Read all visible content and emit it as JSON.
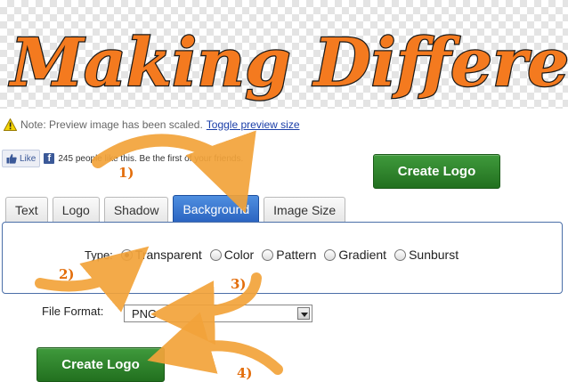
{
  "preview": {
    "logo_text": "Making Different"
  },
  "note": {
    "text": "Note: Preview image has been scaled.",
    "toggle_link": "Toggle preview size"
  },
  "social": {
    "like_label": "Like",
    "like_text": "245 people like this. Be the first of your friends."
  },
  "buttons": {
    "create_logo": "Create Logo"
  },
  "tabs": [
    {
      "label": "Text"
    },
    {
      "label": "Logo"
    },
    {
      "label": "Shadow"
    },
    {
      "label": "Background"
    },
    {
      "label": "Image Size"
    }
  ],
  "background": {
    "type_label": "Type:",
    "options": [
      {
        "label": "Transparent",
        "checked": true
      },
      {
        "label": "Color",
        "checked": false
      },
      {
        "label": "Pattern",
        "checked": false
      },
      {
        "label": "Gradient",
        "checked": false
      },
      {
        "label": "Sunburst",
        "checked": false
      }
    ]
  },
  "file_format": {
    "label": "File Format:",
    "value": "PNG"
  },
  "annotations": {
    "step1": "1)",
    "step2": "2)",
    "step3": "3)",
    "step4": "4)"
  },
  "colors": {
    "accent_orange": "#f47a1f",
    "arrow_orange": "#f2a33a",
    "button_green": "#2e7d2a",
    "tab_active_blue": "#3a74d0"
  },
  "icons": {
    "warning": "warning-icon",
    "thumb": "thumbs-up-icon",
    "facebook": "facebook-icon",
    "dropdown": "chevron-down-icon"
  }
}
